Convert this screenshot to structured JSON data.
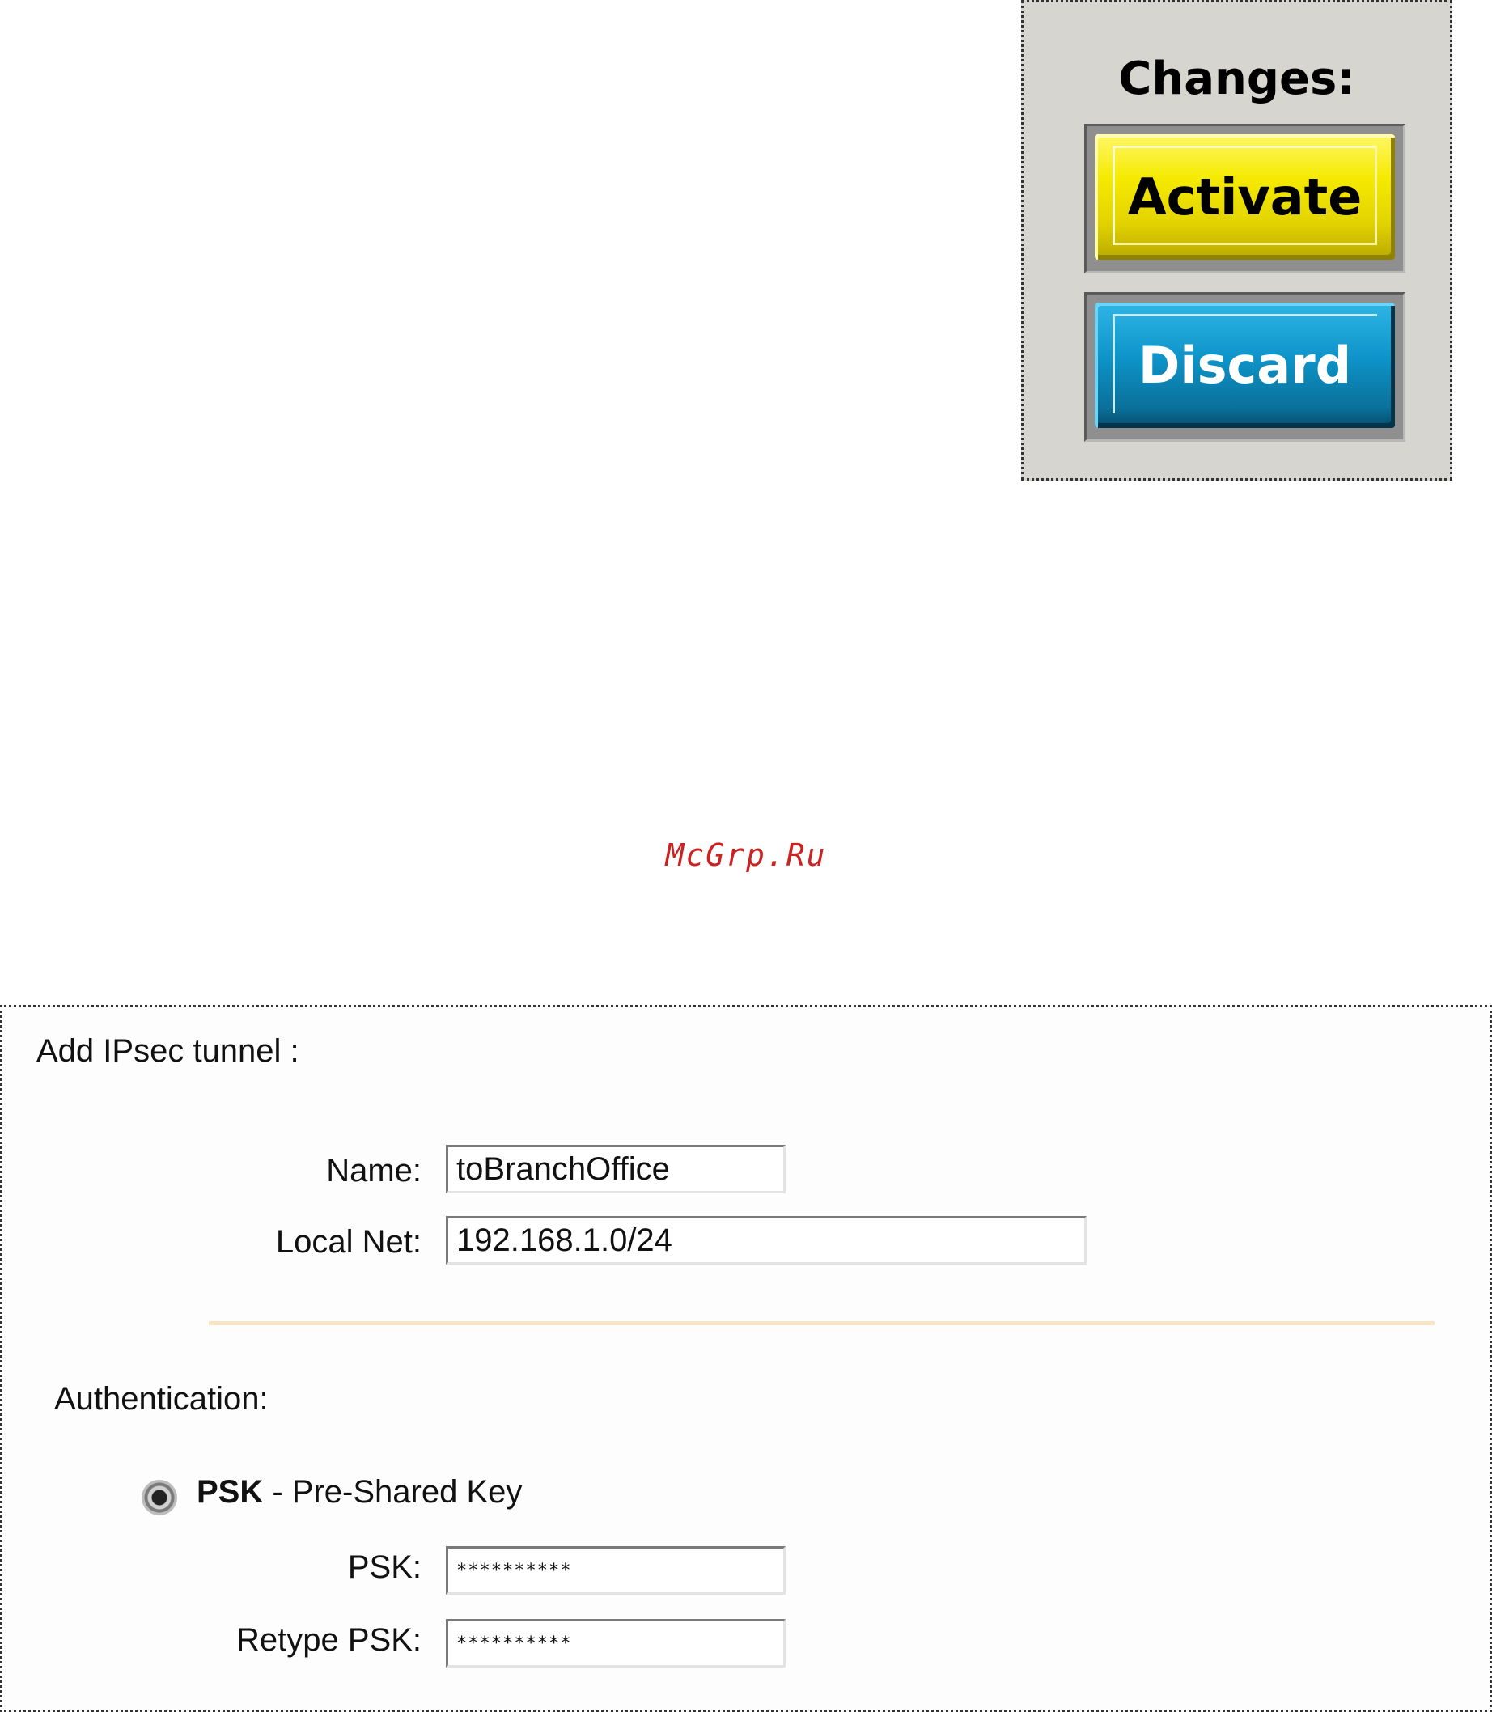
{
  "changes": {
    "title": "Changes:",
    "activate_label": "Activate",
    "discard_label": "Discard",
    "colors": {
      "activate": "#f5ea00",
      "discard": "#0d93c8",
      "panel": "#d6d5cf"
    }
  },
  "watermark": "McGrp.Ru",
  "form": {
    "title": "Add IPsec tunnel :",
    "name_label": "Name:",
    "name_value": "toBranchOffice",
    "local_net_label": "Local Net:",
    "local_net_value": "192.168.1.0/24",
    "auth_label": "Authentication:",
    "psk_option_strong": "PSK",
    "psk_option_rest": " - Pre-Shared Key",
    "psk_option_selected": true,
    "psk_label": "PSK:",
    "psk_value": "**********",
    "retype_psk_label": "Retype PSK:",
    "retype_psk_value": "**********",
    "divider_color": "#f6e4c2"
  }
}
